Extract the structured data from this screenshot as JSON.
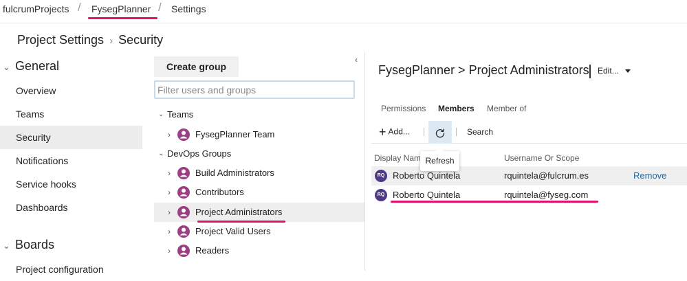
{
  "breadcrumb": {
    "org": "fulcrumProjects",
    "project": "FysegPlanner",
    "page": "Settings",
    "separator": "/"
  },
  "page_header": {
    "title": "Project Settings",
    "subtitle": "Security"
  },
  "nav": {
    "general": {
      "title": "General",
      "items": [
        "Overview",
        "Teams",
        "Security",
        "Notifications",
        "Service hooks",
        "Dashboards"
      ],
      "selected": "Security"
    },
    "boards": {
      "title": "Boards",
      "items": [
        "Project configuration"
      ]
    }
  },
  "groups_panel": {
    "create_button": "Create group",
    "filter_placeholder": "Filter users and groups",
    "teams_header": "Teams",
    "teams": [
      "FysegPlanner Team"
    ],
    "devops_header": "DevOps Groups",
    "devops_groups": [
      "Build Administrators",
      "Contributors",
      "Project Administrators",
      "Project Valid Users",
      "Readers"
    ],
    "selected": "Project Administrators"
  },
  "detail": {
    "title": "FysegPlanner > Project Administrators",
    "edit_label": "Edit...",
    "tabs": [
      "Permissions",
      "Members",
      "Member of"
    ],
    "active_tab": "Members",
    "toolbar": {
      "add_label": "Add...",
      "search_label": "Search",
      "refresh_tooltip": "Refresh"
    },
    "columns": {
      "display_name": "Display Nam",
      "username": "Username Or Scope"
    },
    "members": [
      {
        "initials": "RQ",
        "name": "Roberto Quintela",
        "scope": "rquintela@fulcrum.es",
        "action": "Remove"
      },
      {
        "initials": "RQ",
        "name": "Roberto Quintela",
        "scope": "rquintela@fyseg.com",
        "action": ""
      }
    ]
  },
  "colors": {
    "highlight": "#e0126a",
    "avatar": "#4f3a86",
    "group_icon": "#9b3f85",
    "link": "#1a6cb0",
    "selected_row": "#eeeeee",
    "refresh_active": "#dde9f2"
  },
  "icons": {
    "chevron_right": "›",
    "caret_right": "›",
    "caret_down": "⌄",
    "collapse": "‹",
    "plus": "+",
    "refresh": "↻"
  }
}
